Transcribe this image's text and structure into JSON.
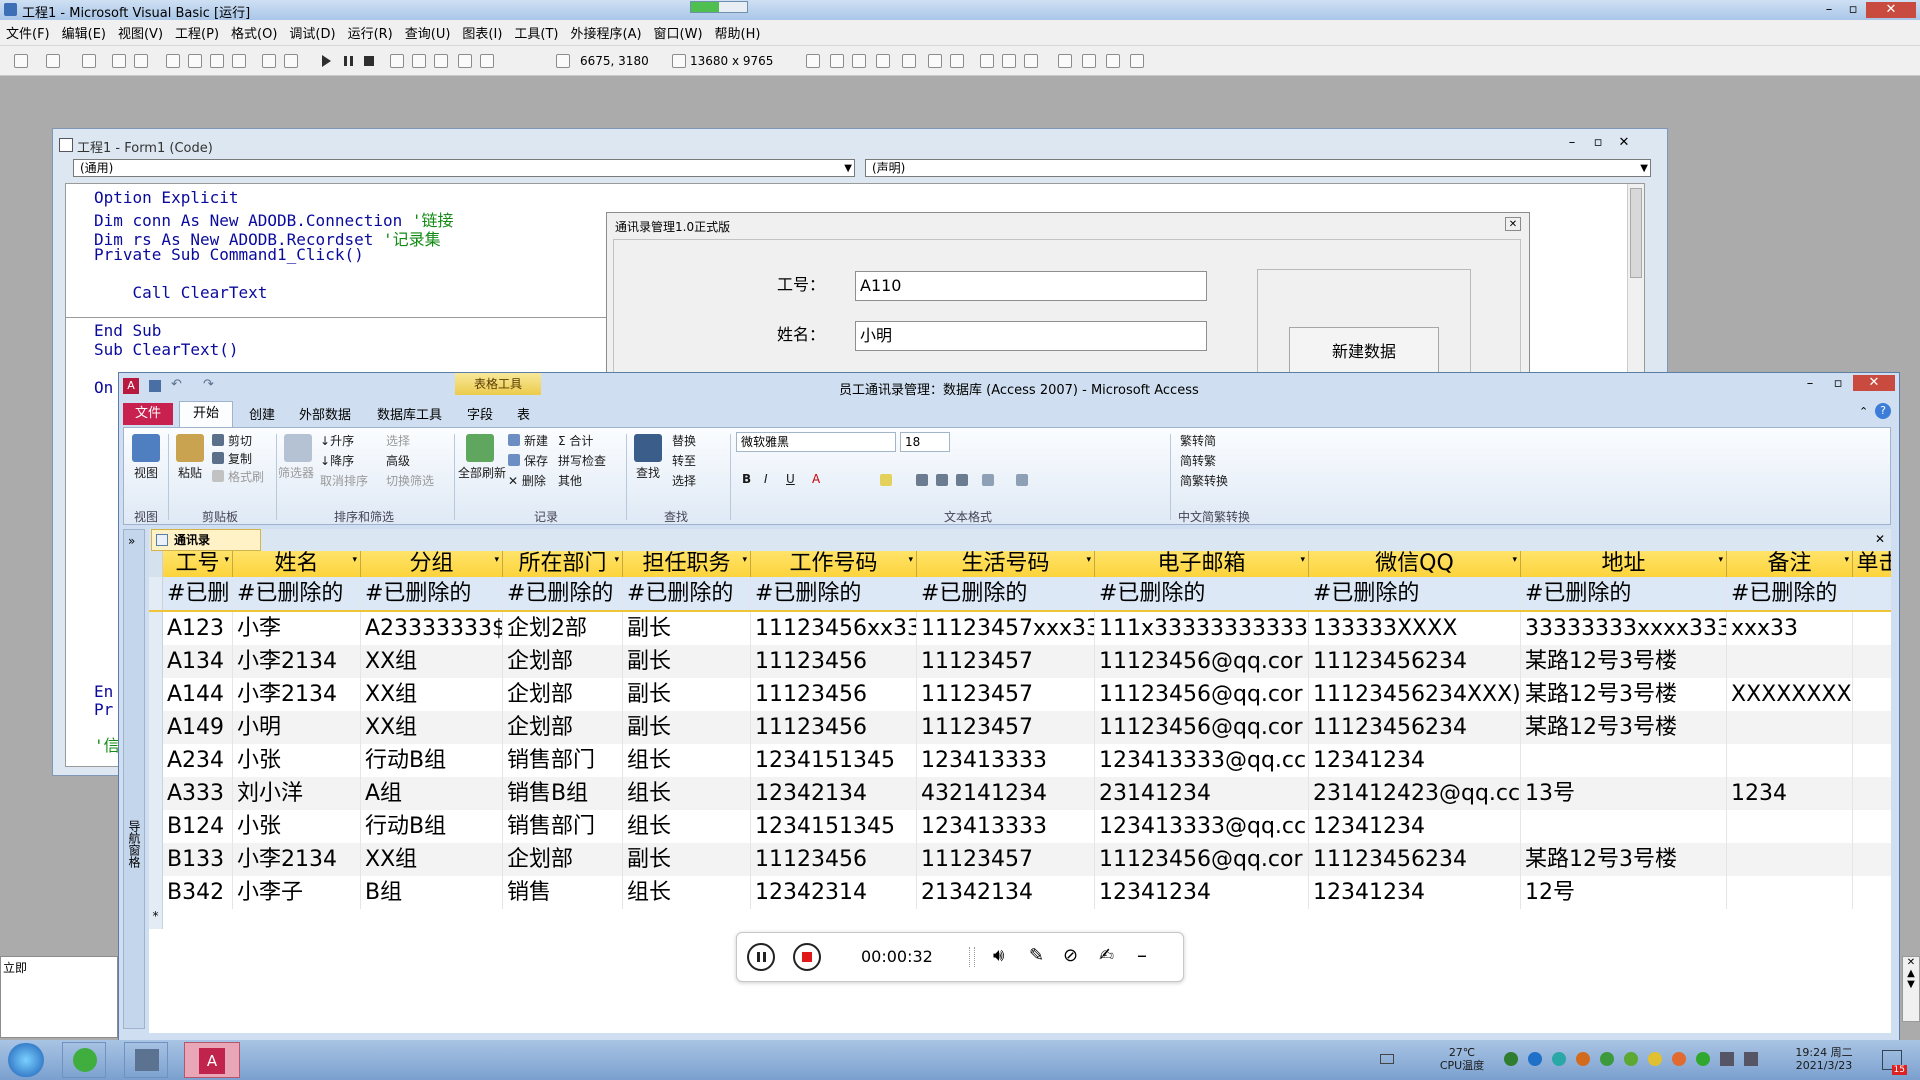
{
  "vb": {
    "window_title": "工程1 - Microsoft Visual Basic [运行]",
    "menu": [
      "文件(F)",
      "编辑(E)",
      "视图(V)",
      "工程(P)",
      "格式(O)",
      "调试(D)",
      "运行(R)",
      "查询(U)",
      "图表(I)",
      "工具(T)",
      "外接程序(A)",
      "窗口(W)",
      "帮助(H)"
    ],
    "toolbar": {
      "position_readout": "6675, 3180",
      "size_readout": "13680 x 9765"
    }
  },
  "code_window": {
    "title": "工程1 - Form1 (Code)",
    "object_combo": "(通用)",
    "proc_combo": "(声明)",
    "lines": [
      {
        "code": "Option Explicit",
        "comment": ""
      },
      {
        "code": "Dim conn As New ADODB.Connection ",
        "comment": "'链接"
      },
      {
        "code": "Dim rs As New ADODB.Recordset ",
        "comment": "'记录集"
      },
      {
        "code": "Private Sub Command1_Click()",
        "comment": ""
      },
      {
        "code": "",
        "comment": ""
      },
      {
        "code": "    Call ClearText",
        "comment": ""
      },
      {
        "code": "",
        "comment": ""
      },
      {
        "code": "End Sub",
        "comment": ""
      },
      {
        "code": "Sub ClearText()",
        "comment": ""
      }
    ],
    "fragments": [
      "On",
      "En",
      "Pr",
      "'信"
    ]
  },
  "form_dialog": {
    "title": "通讯录管理1.0正式版",
    "label_id": "工号：",
    "value_id": "A110",
    "label_name": "姓名：",
    "value_name": "小明",
    "new_button": "新建数据"
  },
  "access": {
    "window_title": "员工通讯录管理：数据库 (Access 2007) - Microsoft Access",
    "context_tab": "表格工具",
    "tabs": [
      "文件",
      "开始",
      "创建",
      "外部数据",
      "数据库工具",
      "字段",
      "表"
    ],
    "ribbon": {
      "groups": [
        "视图",
        "剪贴板",
        "排序和筛选",
        "记录",
        "查找",
        "文本格式",
        "中文简繁转换"
      ],
      "view": "视图",
      "paste": "粘贴",
      "cut": "剪切",
      "copy": "复制",
      "format_painter": "格式刷",
      "filter": "筛选器",
      "ascending": "升序",
      "descending": "降序",
      "remove_sort": "取消排序",
      "selection": "选择",
      "advanced": "高级",
      "toggle_filter": "切换筛选",
      "refresh_all": "全部刷新",
      "new": "新建",
      "save": "保存",
      "delete": "删除",
      "totals": "合计",
      "spelling": "拼写检查",
      "more": "其他",
      "find": "查找",
      "replace": "替换",
      "goto": "转至",
      "select": "选择",
      "font_name": "微软雅黑",
      "font_size": "18",
      "trad_to_simp": "繁转简",
      "simp_to_trad": "简转繁",
      "simp_trad_convert": "简繁转换"
    },
    "nav_pane_label": "导航窗格",
    "table_tab": "通讯录",
    "columns": [
      "工号",
      "姓名",
      "分组",
      "所在部门",
      "担任职务",
      "工作号码",
      "生活号码",
      "电子邮箱",
      "微信QQ",
      "地址",
      "备注",
      "单击"
    ],
    "deleted_row": [
      "#已删",
      "#已删除的",
      "#已删除的",
      "#已删除的",
      "#已删除的",
      "#已删除的",
      "#已删除的",
      "#已删除的",
      "#已删除的",
      "#已删除的",
      "#已删除的",
      ""
    ],
    "rows": [
      [
        "A123",
        "小李",
        "A23333333$",
        "企划2部",
        "副长",
        "11123456xx33",
        "11123457xxx33",
        "111x33333333333",
        "133333XXXX",
        "33333333xxxx333",
        "xxx33",
        ""
      ],
      [
        "A134",
        "小李2134",
        "XX组",
        "企划部",
        "副长",
        "11123456",
        "11123457",
        "11123456@qq.cor",
        "11123456234",
        "某路12号3号楼",
        "",
        ""
      ],
      [
        "A144",
        "小李2134",
        "XX组",
        "企划部",
        "副长",
        "11123456",
        "11123457",
        "11123456@qq.cor",
        "11123456234XXX)",
        "某路12号3号楼",
        "XXXXXXXX",
        ""
      ],
      [
        "A149",
        "小明",
        "XX组",
        "企划部",
        "副长",
        "11123456",
        "11123457",
        "11123456@qq.cor",
        "11123456234",
        "某路12号3号楼",
        "",
        ""
      ],
      [
        "A234",
        "小张",
        "行动B组",
        "销售部门",
        "组长",
        "1234151345",
        "123413333",
        "123413333@qq.cc",
        "12341234",
        "",
        "",
        ""
      ],
      [
        "A333",
        "刘小洋",
        "A组",
        "销售B组",
        "组长",
        "12342134",
        "432141234",
        "23141234",
        "231412423@qq.cc",
        "13号",
        "1234",
        ""
      ],
      [
        "B124",
        "小张",
        "行动B组",
        "销售部门",
        "组长",
        "1234151345",
        "123413333",
        "123413333@qq.cc",
        "12341234",
        "",
        "",
        ""
      ],
      [
        "B133",
        "小李2134",
        "XX组",
        "企划部",
        "副长",
        "11123456",
        "11123457",
        "11123456@qq.cor",
        "11123456234",
        "某路12号3号楼",
        "",
        ""
      ],
      [
        "B342",
        "小李子",
        "B组",
        "销售",
        "组长",
        "12342314",
        "21342134",
        "12341234",
        "12341234",
        "12号",
        "",
        ""
      ]
    ],
    "new_row_marker": "*"
  },
  "recorder": {
    "time": "00:00:32"
  },
  "immediate": {
    "title": "立即"
  },
  "taskbar": {
    "temp": "27℃",
    "cpu_label": "CPU温度",
    "time": "19:24 周二",
    "date": "2021/3/23",
    "badge": "15"
  },
  "colors": {
    "header_yellow": "#fcd33b",
    "file_tab": "#c8214f",
    "deleted_row": "#dde8f6",
    "taskbar": "#8fb1da"
  }
}
